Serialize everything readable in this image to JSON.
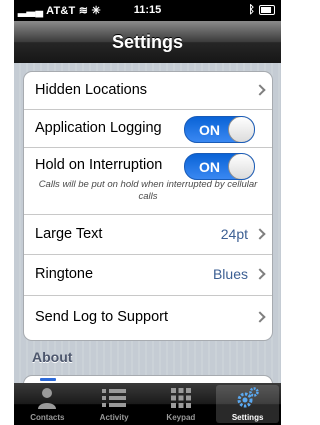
{
  "status": {
    "carrier": "AT&T",
    "time": "11:15"
  },
  "nav": {
    "title": "Settings"
  },
  "settings": {
    "hidden_locations": "Hidden Locations",
    "application_logging": {
      "label": "Application Logging",
      "state": "ON"
    },
    "hold_on_interruption": {
      "label": "Hold on Interruption",
      "state": "ON",
      "note": "Calls will be put on hold when interrupted by cellular calls"
    },
    "large_text": {
      "label": "Large Text",
      "value": "24pt"
    },
    "ringtone": {
      "label": "Ringtone",
      "value": "Blues"
    },
    "send_log": "Send Log to Support"
  },
  "about": {
    "header": "About"
  },
  "tabs": [
    {
      "label": "Contacts",
      "icon": "person-icon",
      "selected": false
    },
    {
      "label": "Activity",
      "icon": "list-icon",
      "selected": false
    },
    {
      "label": "Keypad",
      "icon": "keypad-icon",
      "selected": false
    },
    {
      "label": "Settings",
      "icon": "gears-icon",
      "selected": true
    }
  ],
  "colors": {
    "toggle_blue": "#1a73e8",
    "value_blue": "#3c5f93"
  }
}
